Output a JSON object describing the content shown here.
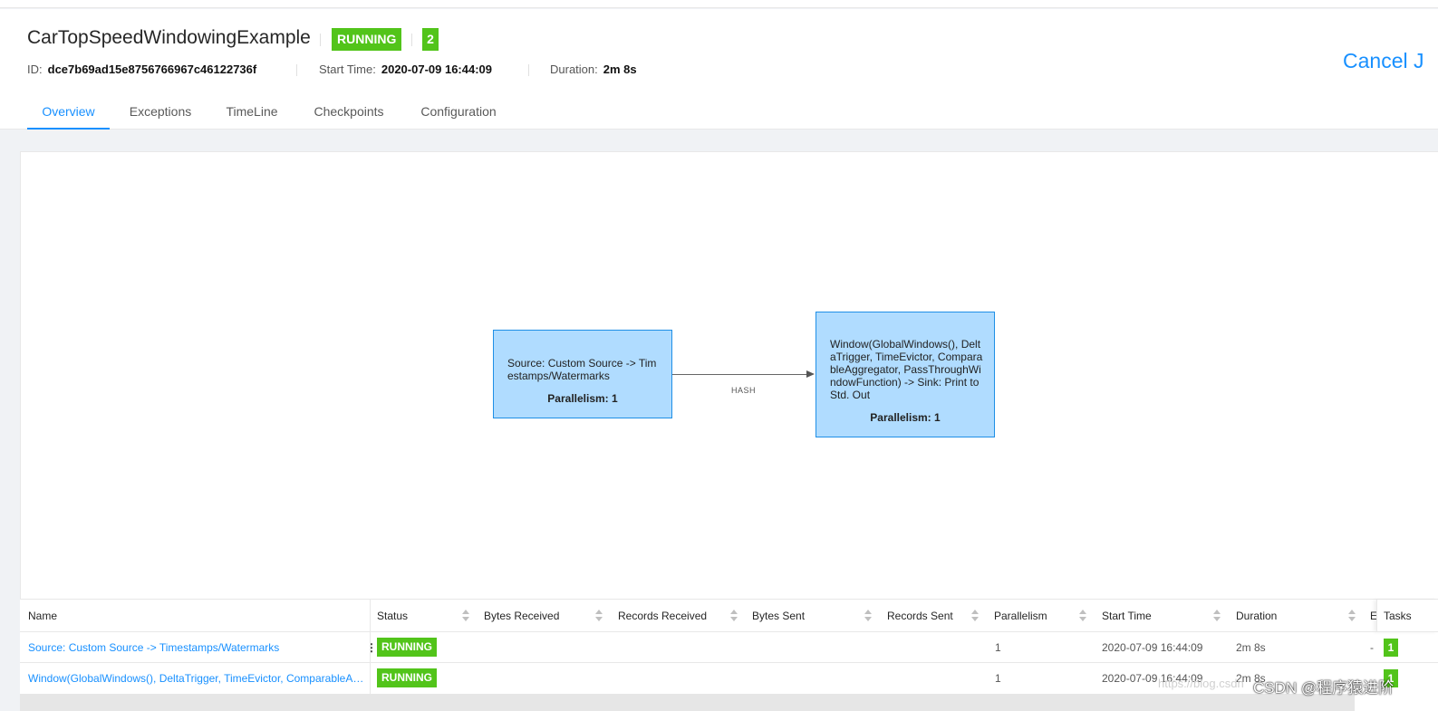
{
  "job": {
    "name": "CarTopSpeedWindowingExample",
    "status": "RUNNING",
    "task_count": "2",
    "id_label": "ID:",
    "id": "dce7b69ad15e8756766967c46122736f",
    "start_label": "Start Time:",
    "start_time": "2020-07-09 16:44:09",
    "duration_label": "Duration:",
    "duration": "2m 8s",
    "cancel_label": "Cancel J"
  },
  "tabs": [
    "Overview",
    "Exceptions",
    "TimeLine",
    "Checkpoints",
    "Configuration"
  ],
  "active_tab": "Overview",
  "graph": {
    "nodes": [
      {
        "description": "Source: Custom Source -> Timestamps/Watermarks",
        "parallelism": "Parallelism: 1"
      },
      {
        "description": "Window(GlobalWindows(), DeltaTrigger, TimeEvictor, ComparableAggregator, PassThroughWindowFunction) -> Sink: Print to Std. Out",
        "parallelism": "Parallelism: 1"
      }
    ],
    "edge_label": "HASH"
  },
  "table": {
    "headers": [
      "Name",
      "Status",
      "Bytes Received",
      "Records Received",
      "Bytes Sent",
      "Records Sent",
      "Parallelism",
      "Start Time",
      "Duration",
      "E",
      "Tasks"
    ],
    "rows": [
      {
        "name": "Source: Custom Source -> Timestamps/Watermarks",
        "status": "RUNNING",
        "parallelism": "1",
        "start_time": "2020-07-09 16:44:09",
        "duration": "2m 8s",
        "end": "-",
        "tasks": "1"
      },
      {
        "name": "Window(GlobalWindows(), DeltaTrigger, TimeEvictor, ComparableAgg...",
        "status": "RUNNING",
        "parallelism": "1",
        "start_time": "2020-07-09 16:44:09",
        "duration": "2m 8s",
        "end": "",
        "tasks": "1"
      }
    ]
  },
  "watermark": {
    "url": "https://blog.csdn",
    "text": "CSDN @程序猿进阶"
  },
  "colors": {
    "accent": "#1890ff",
    "running": "#52c41a",
    "node_fill": "#b0dcff",
    "node_border": "#1f8fe6"
  }
}
